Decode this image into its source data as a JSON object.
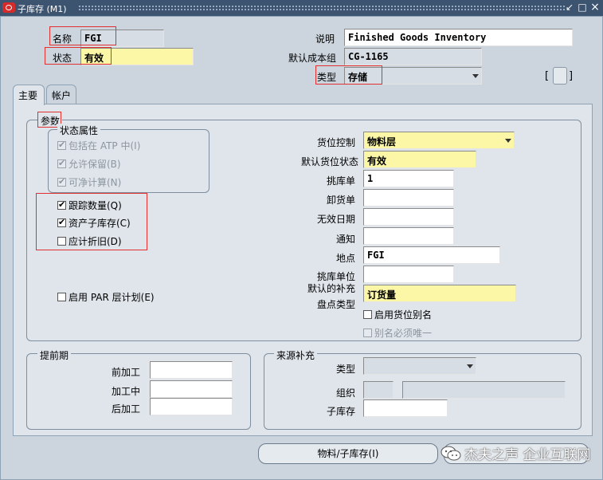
{
  "window": {
    "title": "子库存 (M1)",
    "minimize": "↙",
    "maximize": "□",
    "close": "×"
  },
  "header": {
    "name_label": "名称",
    "name_value": "FGI",
    "status_label": "状态",
    "status_value": "有效",
    "description_label": "说明",
    "description_value": "Finished Goods Inventory",
    "cost_group_label": "默认成本组",
    "cost_group_value": "CG-1165",
    "type_label": "类型",
    "type_value": "存储",
    "bracket_left": "[",
    "bracket_right": "]"
  },
  "tabs": [
    {
      "label": "主要",
      "active": true
    },
    {
      "label": "帐户",
      "active": false
    }
  ],
  "parameters": {
    "title": "参数",
    "status_attrs_title": "状态属性",
    "include_atp": "包括在 ATP 中(I)",
    "allow_reservation": "允许保留(B)",
    "nettable": "可净计算(N)",
    "track_quantity": "跟踪数量(Q)",
    "asset_subinventory": "资产子库存(C)",
    "depreciable": "应计折旧(D)",
    "enable_par": "启用 PAR 层计划(E)",
    "locator_control_label": "货位控制",
    "locator_control_value": "物料层",
    "default_locator_status_label": "默认货位状态",
    "default_locator_status_value": "有效",
    "picking_unit_label": "挑库单",
    "picking_unit_value": "1",
    "dropping_order_label": "卸货单",
    "dropping_order_value": "",
    "inactive_date_label": "无效日期",
    "inactive_date_value": "",
    "notify_label": "通知",
    "notify_value": "",
    "location_label": "地点",
    "location_value": "FGI",
    "picking_uom_label": "挑库单位",
    "picking_uom_value": "",
    "default_replenish_label": "默认的补充",
    "count_type_label": "盘点类型",
    "count_type_value": "订货量",
    "enable_locator_alias": "启用货位别名",
    "alias_unique": "别名必须唯一"
  },
  "lead_times": {
    "title": "提前期",
    "preprocessing_label": "前加工",
    "preprocessing_value": "",
    "processing_label": "加工中",
    "processing_value": "",
    "postprocessing_label": "后加工",
    "postprocessing_value": ""
  },
  "sourcing": {
    "title": "来源补充",
    "type_label": "类型",
    "type_value": "",
    "org_label": "组织",
    "org_code": "",
    "org_name": "",
    "subinventory_label": "子库存",
    "subinventory_value": ""
  },
  "footer": {
    "item_subinventory_button": "物料/子库存(I)"
  },
  "watermark": {
    "text": "杰夫之声 企业互联网"
  }
}
